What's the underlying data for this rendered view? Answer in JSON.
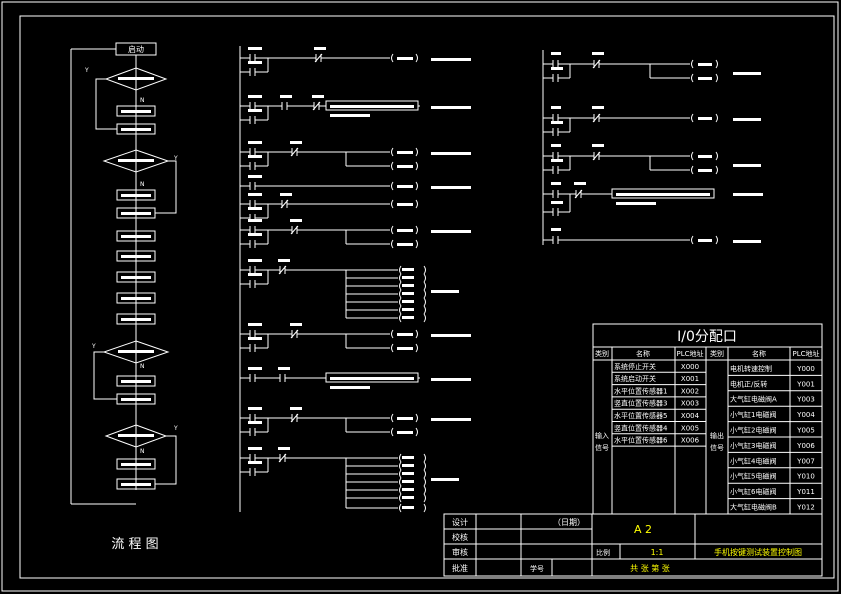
{
  "flowchart": {
    "title": "流 程 图",
    "start": "启动",
    "yes": "Y",
    "no": "N"
  },
  "io_table": {
    "title": "I/0分配口",
    "headers": [
      "类别",
      "名称",
      "PLC地址",
      "类别",
      "名称",
      "PLC地址"
    ],
    "input_category": [
      "输入",
      "信号"
    ],
    "output_category": [
      "输出",
      "信号"
    ],
    "inputs": [
      {
        "name": "系统停止开关",
        "addr": "X000"
      },
      {
        "name": "系统启动开关",
        "addr": "X001"
      },
      {
        "name": "水平位置传感器1",
        "addr": "X002"
      },
      {
        "name": "竖直位置传感器3",
        "addr": "X003"
      },
      {
        "name": "水平位置传感器5",
        "addr": "X004"
      },
      {
        "name": "竖直位置传感器4",
        "addr": "X005"
      },
      {
        "name": "水平位置传感器6",
        "addr": "X006"
      }
    ],
    "outputs": [
      {
        "name": "电机转速控制",
        "addr": "Y000"
      },
      {
        "name": "电机正/反转",
        "addr": "Y001"
      },
      {
        "name": "大气缸电磁阀A",
        "addr": "Y003"
      },
      {
        "name": "小气缸1电磁阀",
        "addr": "Y004"
      },
      {
        "name": "小气缸2电磁阀",
        "addr": "Y005"
      },
      {
        "name": "小气缸3电磁阀",
        "addr": "Y006"
      },
      {
        "name": "小气缸4电磁阀",
        "addr": "Y007"
      },
      {
        "name": "小气缸5电磁阀",
        "addr": "Y010"
      },
      {
        "name": "小气缸6电磁阀",
        "addr": "Y011"
      },
      {
        "name": "大气缸电磁阀B",
        "addr": "Y012"
      }
    ]
  },
  "title_block": {
    "design": "设计",
    "date": "（日期）",
    "check": "校核",
    "review": "审核",
    "approve": "批准",
    "number_label": "学号",
    "sheet_size": "A 2",
    "scale_label": "比例",
    "scale": "1:1",
    "drawing_title": "手机按键测试装置控制图",
    "sheets": "共 张 第 张"
  },
  "ladder": {
    "outputs": [
      "Y000",
      "Y001",
      "Y003",
      "Y004",
      "Y005",
      "Y006",
      "Y007",
      "Y010",
      "Y011",
      "Y012"
    ],
    "rst": "RST"
  }
}
